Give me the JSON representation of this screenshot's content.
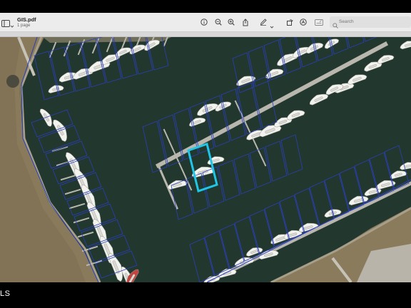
{
  "document": {
    "title": "GIS.pdf",
    "subtitle": "1 page"
  },
  "toolbar": {
    "search_placeholder": "Search",
    "icons": [
      "sidebar-icon",
      "chevron-down-icon",
      "info-icon",
      "zoom-out-icon",
      "zoom-in-icon",
      "share-icon",
      "pen-icon",
      "chevron-down-icon",
      "rotate-icon",
      "markup-icon",
      "form-icon",
      "search-icon"
    ]
  },
  "map": {
    "water_color": "#22382f",
    "land_color": "#8a7a5c",
    "parcel_outline_color": "#2b3fb5",
    "highlight_color": "#1fc6e8"
  },
  "caption": {
    "text": "LS"
  }
}
